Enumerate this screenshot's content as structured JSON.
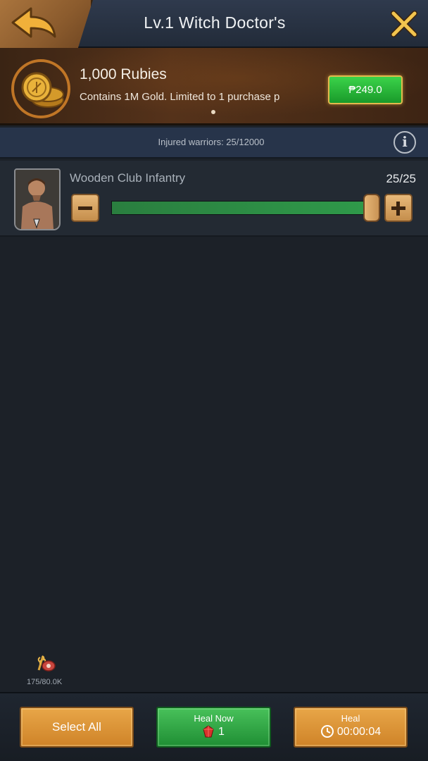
{
  "header": {
    "title": "Lv.1 Witch Doctor's"
  },
  "offer": {
    "title": "1,000 Rubies",
    "description": "Contains 1M Gold. Limited to 1 purchase p",
    "price": "₱249.0"
  },
  "injured": {
    "label": "Injured warriors: 25/12000"
  },
  "troop": {
    "name": "Wooden Club Infantry",
    "count": "25/25",
    "selected_fraction": 1.0
  },
  "food": {
    "amount": "175/80.0K"
  },
  "footer": {
    "select_all": "Select All",
    "heal_now_label": "Heal Now",
    "heal_now_cost": "1",
    "heal_label": "Heal",
    "heal_time": "00:00:04"
  },
  "colors": {
    "accent_green": "#2f9a4a",
    "wood": "#cf8328",
    "background": "#1c2128"
  }
}
